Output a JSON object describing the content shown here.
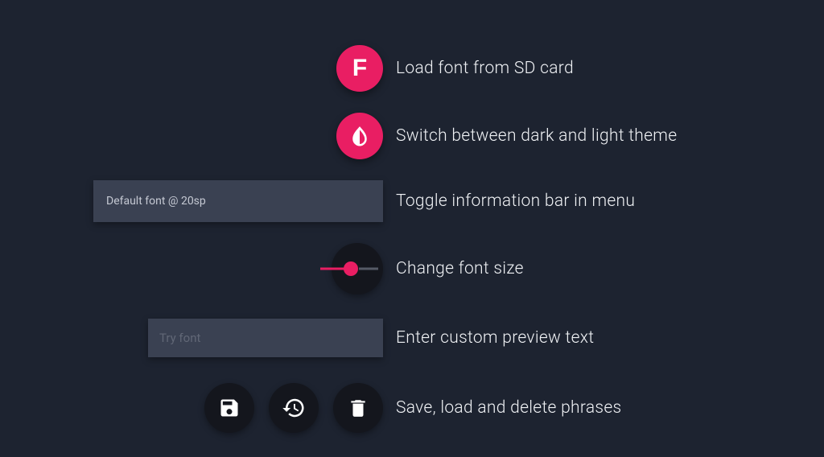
{
  "rows": {
    "font": {
      "label": "Load font from SD card",
      "icon_letter": "F"
    },
    "theme": {
      "label": "Switch between dark and light theme"
    },
    "info": {
      "label": "Toggle information bar in menu",
      "bar_text": "Default font @ 20sp"
    },
    "size": {
      "label": "Change font size"
    },
    "preview": {
      "label": "Enter custom preview text",
      "placeholder": "Try font"
    },
    "phrases": {
      "label": "Save, load and delete phrases"
    }
  }
}
